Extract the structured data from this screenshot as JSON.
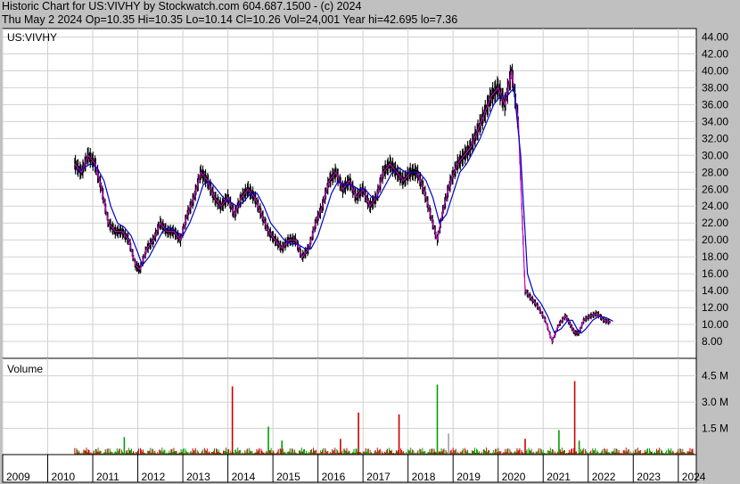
{
  "header": {
    "line1": "Historic Chart for US:VIVHY by Stockwatch.com 604.687.1500 - (c) 2024",
    "line2": "Thu May  2 2024   Op=10.35   Hi=10.35   Lo=10.14   Cl=10.26   Vol=24,001   Year hi=42.695   lo=7.36"
  },
  "chart_data": [
    {
      "type": "line",
      "title": "US:VIVHY",
      "x": [
        2010.6,
        2010.75,
        2010.9,
        2011.05,
        2011.2,
        2011.35,
        2011.5,
        2011.65,
        2011.8,
        2011.95,
        2012.05,
        2012.2,
        2012.35,
        2012.5,
        2012.65,
        2012.8,
        2012.95,
        2013.1,
        2013.25,
        2013.4,
        2013.55,
        2013.7,
        2013.85,
        2014.0,
        2014.15,
        2014.3,
        2014.45,
        2014.6,
        2014.75,
        2014.9,
        2015.05,
        2015.2,
        2015.35,
        2015.5,
        2015.65,
        2015.8,
        2015.95,
        2016.1,
        2016.25,
        2016.4,
        2016.55,
        2016.7,
        2016.85,
        2017.0,
        2017.15,
        2017.3,
        2017.45,
        2017.6,
        2017.75,
        2017.9,
        2018.05,
        2018.2,
        2018.35,
        2018.5,
        2018.65,
        2018.8,
        2018.95,
        2019.1,
        2019.25,
        2019.4,
        2019.55,
        2019.7,
        2019.85,
        2020.0,
        2020.15,
        2020.3,
        2020.45,
        2020.6,
        2020.75,
        2020.9,
        2021.05,
        2021.2,
        2021.35,
        2021.5,
        2021.6,
        2021.7,
        2021.8,
        2021.9,
        2022.05,
        2022.2,
        2022.35,
        2022.5,
        2022.65,
        2022.8,
        2022.95,
        2023.1,
        2023.25,
        2023.4,
        2023.55,
        2023.7,
        2023.85,
        2024.0,
        2024.15,
        2024.33
      ],
      "series": [
        {
          "values": [
            29,
            28,
            30,
            29,
            26,
            22,
            21,
            21,
            20,
            17,
            16.5,
            19,
            20,
            22,
            21,
            21,
            20,
            23,
            25,
            28,
            27,
            25,
            24,
            25,
            23,
            25,
            26,
            25,
            23,
            21,
            20,
            19,
            20,
            20,
            18,
            19,
            22,
            24,
            27,
            28,
            26,
            27,
            25,
            26,
            24,
            25,
            28,
            29,
            28,
            27,
            28,
            28,
            26,
            23,
            20,
            24,
            27,
            29,
            30,
            31,
            33,
            35,
            37,
            38,
            36,
            40,
            34,
            14,
            13,
            12,
            10.5,
            8,
            10,
            11,
            10,
            9,
            9,
            10.5,
            11,
            11.3,
            10.5,
            10.26
          ]
        },
        {
          "values": [
            28,
            28.5,
            29,
            28.5,
            27,
            24,
            22,
            21.5,
            20.5,
            18.5,
            17,
            18,
            19.5,
            21,
            21.5,
            21,
            20.5,
            22,
            24,
            26.5,
            27,
            26,
            25,
            24.5,
            24,
            24.5,
            25.5,
            25.5,
            24,
            22,
            21,
            20,
            19.5,
            19.5,
            19,
            19,
            20.5,
            23,
            25.5,
            27,
            26.5,
            26.5,
            26,
            26,
            25,
            25,
            26.5,
            28,
            28.5,
            28,
            28,
            28,
            27,
            25,
            22,
            23,
            25.5,
            28,
            29,
            30.5,
            32,
            34,
            36,
            37,
            37,
            38,
            30,
            16,
            13.5,
            12.5,
            11,
            9,
            9.5,
            10.5,
            10.5,
            9.5,
            9,
            9.5,
            10.5,
            11,
            10.8,
            10.4
          ]
        }
      ],
      "ylim": [
        6,
        45
      ],
      "yticks": [
        "44.00",
        "42.00",
        "40.00",
        "38.00",
        "36.00",
        "34.00",
        "32.00",
        "30.00",
        "28.00",
        "26.00",
        "24.00",
        "22.00",
        "20.00",
        "18.00",
        "16.00",
        "14.00",
        "12.00",
        "10.00",
        "8.00"
      ],
      "xlim": [
        2009,
        2024.4
      ],
      "xticks": [
        "2009",
        "2010",
        "2011",
        "2012",
        "2013",
        "2014",
        "2015",
        "2016",
        "2017",
        "2018",
        "2019",
        "2020",
        "2021",
        "2022",
        "2023",
        "2024"
      ],
      "grid": true,
      "colors": {
        "price": "#000000",
        "ma_short": "#cc00cc",
        "ma_long": "#0000cc"
      }
    },
    {
      "type": "bar",
      "title": "Volume",
      "ylim": [
        0,
        5.5
      ],
      "yticks": [
        "4.5 M",
        "3.0 M",
        "1.5 M"
      ],
      "spikes": [
        {
          "x": 2011.7,
          "v": 1.0,
          "color": "#00a000"
        },
        {
          "x": 2014.1,
          "v": 3.9,
          "color": "#cc0000"
        },
        {
          "x": 2014.9,
          "v": 1.6,
          "color": "#00a000"
        },
        {
          "x": 2015.2,
          "v": 0.8,
          "color": "#00a000"
        },
        {
          "x": 2016.5,
          "v": 0.9,
          "color": "#cc0000"
        },
        {
          "x": 2016.9,
          "v": 2.4,
          "color": "#cc0000"
        },
        {
          "x": 2017.8,
          "v": 2.3,
          "color": "#cc0000"
        },
        {
          "x": 2018.65,
          "v": 4.0,
          "color": "#00a000"
        },
        {
          "x": 2018.9,
          "v": 1.2,
          "color": "#a0a0a0"
        },
        {
          "x": 2020.6,
          "v": 0.9,
          "color": "#cc0000"
        },
        {
          "x": 2021.35,
          "v": 1.4,
          "color": "#00a000"
        },
        {
          "x": 2021.7,
          "v": 4.2,
          "color": "#cc0000"
        },
        {
          "x": 2021.8,
          "v": 0.8,
          "color": "#00a000"
        }
      ]
    }
  ]
}
